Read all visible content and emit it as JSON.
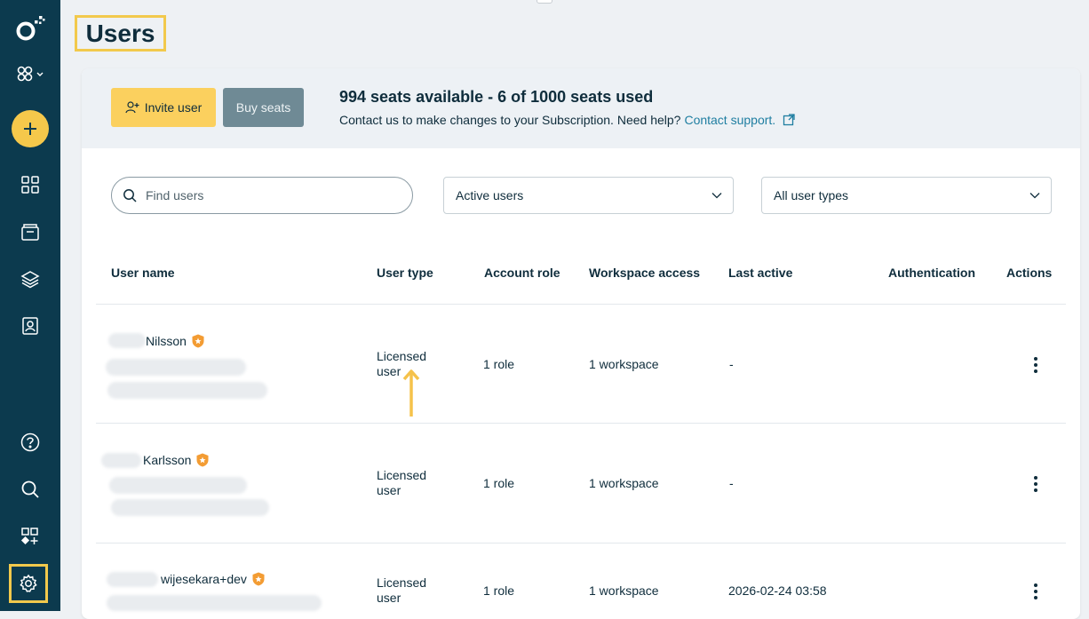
{
  "page": {
    "title": "Users"
  },
  "sidebar": {
    "items": [
      {
        "name": "logo-icon"
      },
      {
        "name": "workspace-switcher"
      },
      {
        "name": "create-icon"
      },
      {
        "name": "dashboard-icon"
      },
      {
        "name": "inbox-icon"
      },
      {
        "name": "layers-icon"
      },
      {
        "name": "contacts-icon"
      },
      {
        "name": "help-icon"
      },
      {
        "name": "search-icon"
      },
      {
        "name": "apps-icon"
      },
      {
        "name": "settings-icon"
      }
    ]
  },
  "header": {
    "invite_label": "Invite user",
    "buy_label": "Buy seats",
    "seats_title": "994 seats available - 6 of 1000 seats used",
    "seats_info": "Contact us to make changes to your Subscription. Need help?",
    "support_link": "Contact support."
  },
  "filters": {
    "search_placeholder": "Find users",
    "status_value": "Active users",
    "type_value": "All user types"
  },
  "table": {
    "columns": [
      "User name",
      "User type",
      "Account role",
      "Workspace access",
      "Last active",
      "Authentication",
      "Actions"
    ],
    "rows": [
      {
        "name": "Nilsson",
        "type": "Licensed user",
        "role": "1 role",
        "access": "1 workspace",
        "last_active": "-",
        "auth": ""
      },
      {
        "name": "Karlsson",
        "type": "Licensed user",
        "role": "1 role",
        "access": "1 workspace",
        "last_active": "-",
        "auth": ""
      },
      {
        "name": "wijesekara+dev",
        "type": "Licensed user",
        "role": "1 role",
        "access": "1 workspace",
        "last_active": "2026-02-24 03:58",
        "auth": ""
      }
    ]
  },
  "colors": {
    "sidebar": "#0c3a4e",
    "accent": "#fbd05e",
    "highlight": "#f2c94c",
    "link": "#1f7ea1",
    "badge": "#f39c33"
  }
}
